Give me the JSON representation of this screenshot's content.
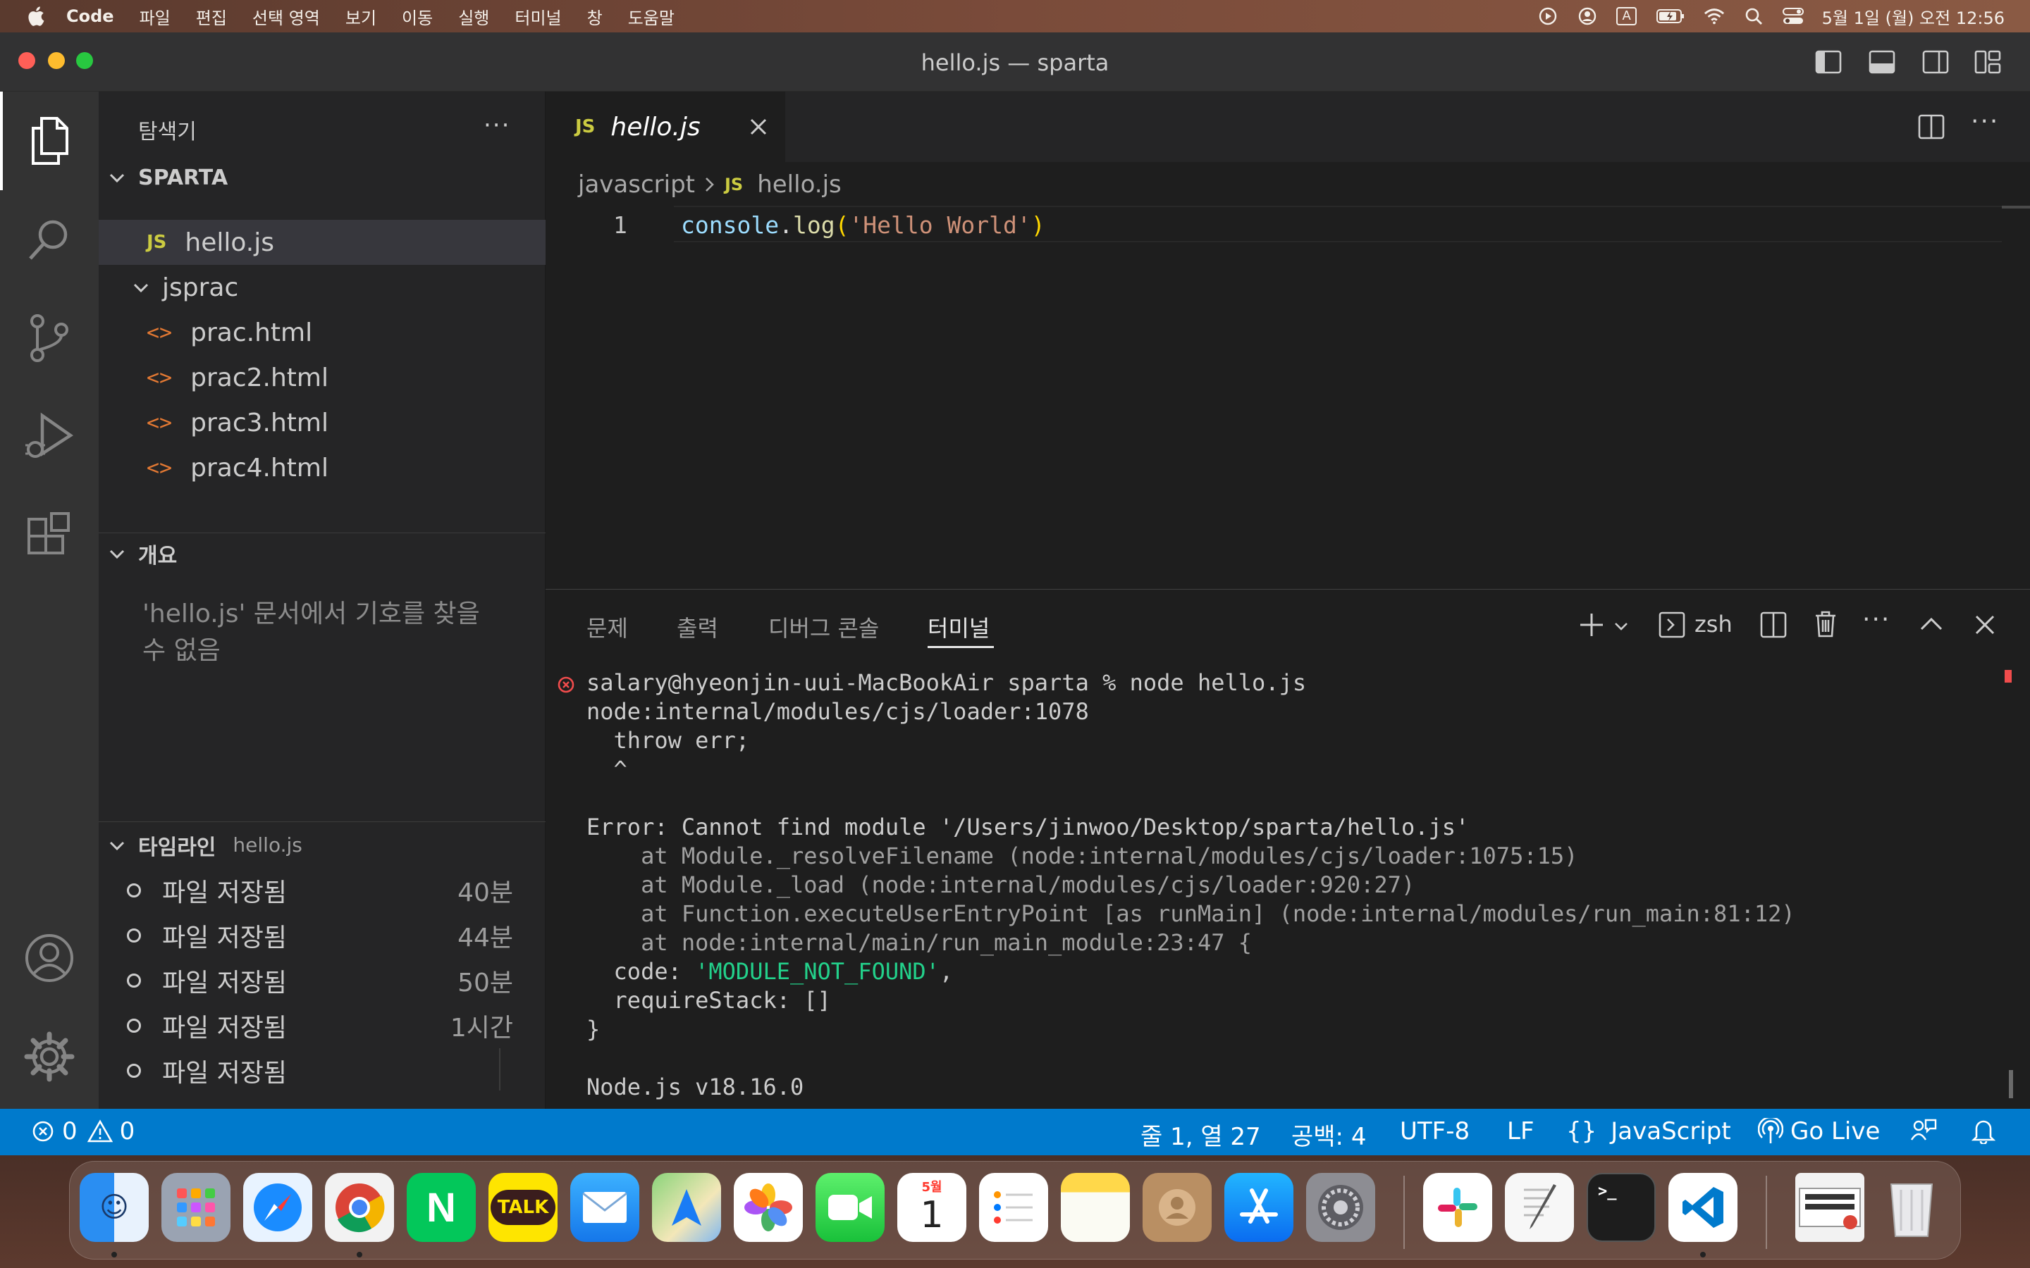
{
  "menubar": {
    "app": "Code",
    "items": [
      "파일",
      "편집",
      "선택 영역",
      "보기",
      "이동",
      "실행",
      "터미널",
      "창",
      "도움말"
    ],
    "input_indicator": "A",
    "clock": "5월 1일 (월) 오전 12:56"
  },
  "window": {
    "title": "hello.js — sparta"
  },
  "sidebar": {
    "explorer_title": "탐색기",
    "folder_name": "SPARTA",
    "files": [
      {
        "label": "hello.js",
        "type": "js",
        "badge": "JS"
      },
      {
        "label": "jsprac",
        "type": "folder"
      },
      {
        "label": "prac.html",
        "type": "html"
      },
      {
        "label": "prac2.html",
        "type": "html"
      },
      {
        "label": "prac3.html",
        "type": "html"
      },
      {
        "label": "prac4.html",
        "type": "html"
      }
    ],
    "outline_title": "개요",
    "outline_message": "'hello.js' 문서에서 기호를 찾을 수 없음",
    "timeline_title": "타임라인",
    "timeline_file": "hello.js",
    "timeline": [
      {
        "label": "파일 저장됨",
        "time": "40분"
      },
      {
        "label": "파일 저장됨",
        "time": "44분"
      },
      {
        "label": "파일 저장됨",
        "time": "50분"
      },
      {
        "label": "파일 저장됨",
        "time": "1시간"
      },
      {
        "label": "파일 저장됨",
        "time": ""
      }
    ]
  },
  "editor": {
    "tab_badge": "JS",
    "tab_label": "hello.js",
    "breadcrumb": [
      "javascript",
      "hello.js"
    ],
    "line_number": "1",
    "code": {
      "obj": "console",
      "dot": ".",
      "fn": "log",
      "open": "(",
      "str": "'Hello World'",
      "close": ")"
    }
  },
  "panel": {
    "tabs": [
      "문제",
      "출력",
      "디버그 콘솔",
      "터미널"
    ],
    "active_tab": "터미널",
    "shell": "zsh",
    "terminal": {
      "prompt": "salary@hyeonjin-uui-MacBookAir sparta % node hello.js",
      "lines_a": [
        "node:internal/modules/cjs/loader:1078",
        "  throw err;",
        "  ^",
        "",
        "Error: Cannot find module '/Users/jinwoo/Desktop/sparta/hello.js'"
      ],
      "stack": [
        "    at Module._resolveFilename (node:internal/modules/cjs/loader:1075:15)",
        "    at Module._load (node:internal/modules/cjs/loader:920:27)",
        "    at Function.executeUserEntryPoint [as runMain] (node:internal/modules/run_main:81:12)",
        "    at node:internal/main/run_main_module:23:47 {"
      ],
      "code_key": "  code: ",
      "code_val": "'MODULE_NOT_FOUND'",
      "code_tail": ",",
      "lines_b": [
        "  requireStack: []",
        "}",
        "",
        "Node.js v18.16.0"
      ]
    }
  },
  "statusbar": {
    "errors": "0",
    "warnings": "0",
    "position": "줄 1, 열 27",
    "spaces": "공백: 4",
    "encoding": "UTF-8",
    "eol": "LF",
    "language": "JavaScript",
    "golive": "Go Live"
  },
  "dock": {
    "apps": [
      "finder",
      "launchpad",
      "safari",
      "chrome",
      "naver",
      "kakaotalk",
      "mail",
      "maps",
      "photos",
      "facetime",
      "calendar",
      "reminders",
      "notes",
      "contacts",
      "app-store",
      "system-settings",
      "slack",
      "textedit",
      "terminal",
      "vscode",
      "screenshot",
      "trash"
    ],
    "calendar_month": "5월",
    "calendar_day": "1",
    "kakao_label": "TALK",
    "naver_label": "N"
  },
  "colors": {
    "accent": "#007acc",
    "keyword_blue": "#9cdcfe",
    "function_yellow": "#dcdcaa",
    "string_orange": "#ce9178",
    "terminal_green": "#23d18b",
    "error_red": "#f14c4c"
  }
}
